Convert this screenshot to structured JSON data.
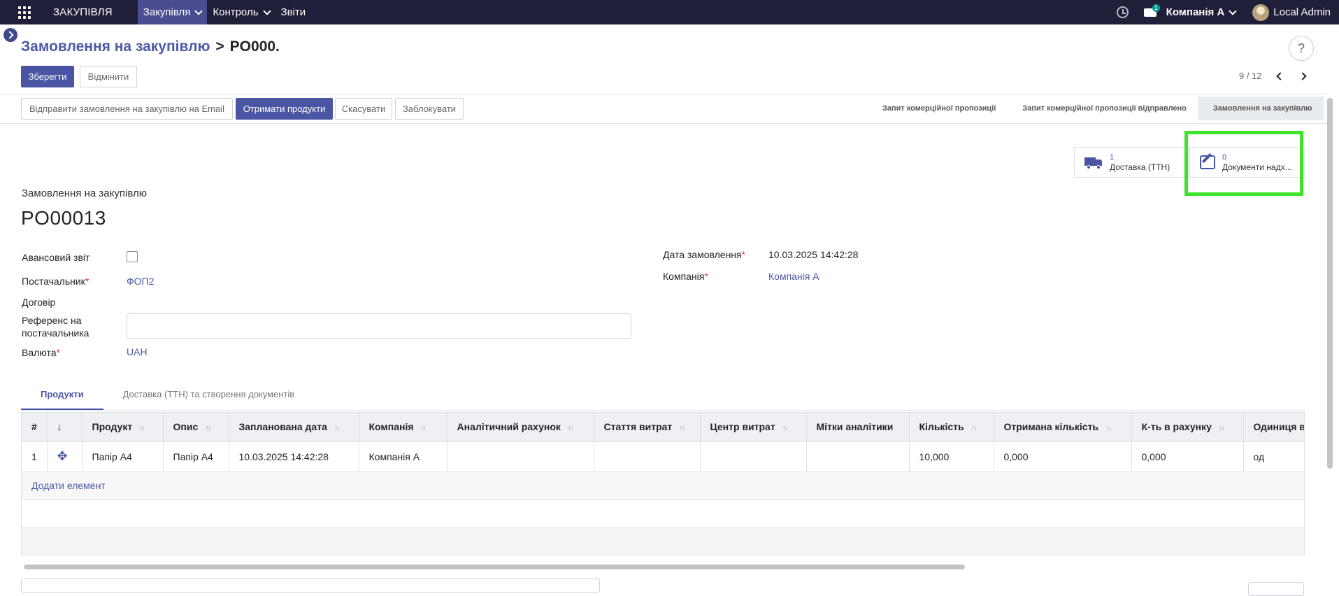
{
  "navbar": {
    "brand": "ЗАКУПІВЛЯ",
    "menu": [
      {
        "label": "Закупівля"
      },
      {
        "label": "Контроль"
      },
      {
        "label": "Звіти"
      }
    ],
    "chat_badge": "1",
    "company": "Компанія А",
    "user": "Local Admin"
  },
  "breadcrumb": {
    "parent": "Замовлення на закупівлю",
    "separator": ">",
    "current": "PO000."
  },
  "help": "?",
  "actions": {
    "save": "Зберегти",
    "discard": "Відмінити"
  },
  "pager": {
    "value": "9 / 12"
  },
  "header_buttons": {
    "send_email": "Відправити замовлення на закупівлю на Email",
    "receive": "Отримати продукти",
    "cancel": "Скасувати",
    "lock": "Заблокувати"
  },
  "status": {
    "stages": [
      "Запит комерційної пропозиції",
      "Запит комерційної пропозиції відправлено",
      "Замовлення на закупівлю"
    ],
    "active": "Замовлення на закупівлю"
  },
  "smart_buttons": [
    {
      "count": "1",
      "label": "Доставка (ТТН)",
      "icon": "truck-icon"
    },
    {
      "count": "0",
      "label": "Документи надх...",
      "icon": "edit-icon"
    }
  ],
  "form": {
    "doc_type": "Замовлення на закупівлю",
    "doc_name": "PO00013",
    "advance_report_label": "Авансовий звіт",
    "vendor_label": "Постачальник",
    "vendor_value": "ФОП2",
    "contract_label": "Договір",
    "vendor_ref_label_1": "Референс на",
    "vendor_ref_label_2": "постачальника",
    "currency_label": "Валюта",
    "currency_value": "UAH",
    "order_date_label": "Дата замовлення",
    "order_date_value": "10.03.2025 14:42:28",
    "company_label": "Компанія",
    "company_value": "Компанія А",
    "required_mark": "*"
  },
  "tabs": [
    {
      "label": "Продукти"
    },
    {
      "label": "Доставка (ТТН) та створення документів"
    }
  ],
  "table": {
    "headers": [
      "#",
      "↓",
      "Продукт",
      "Опис",
      "Запланована дата",
      "Компанія",
      "Аналітичний рахунок",
      "Стаття витрат",
      "Центр витрат",
      "Мітки аналітики",
      "Кількість",
      "Отримана кількість",
      "К-ть в рахунку",
      "Одиниця в"
    ],
    "rows": [
      [
        "1",
        "",
        "Папір А4",
        "Папір А4",
        "10.03.2025 14:42:28",
        "Компанія А",
        "",
        "",
        "",
        "",
        "10,000",
        "0,000",
        "0,000",
        "од"
      ]
    ],
    "add_line": "Додати елемент"
  },
  "colors": {
    "navbar": "#1f1f3a",
    "primary": "#4a55a3",
    "highlight": "#3ee32a"
  }
}
